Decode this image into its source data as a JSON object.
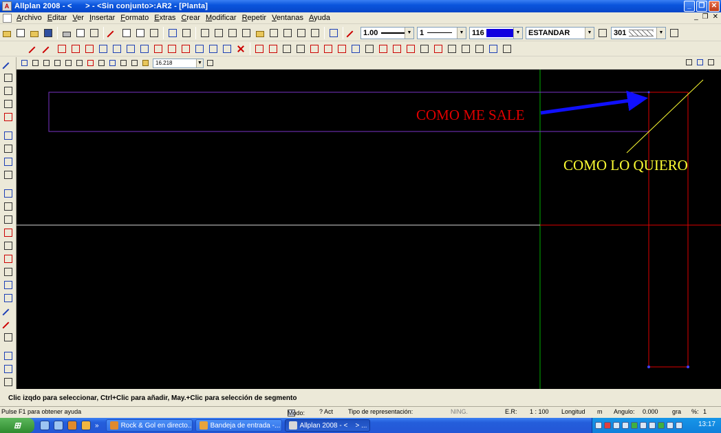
{
  "window": {
    "title": "Allplan 2008 - <      > - <Sin conjunto>:AR2 - [Planta]",
    "app_icon": "allplan-logo-icon",
    "controls": [
      "minimize-icon",
      "restore-icon",
      "close-icon"
    ]
  },
  "menu": {
    "items": [
      "Archivo",
      "Editar",
      "Ver",
      "Insertar",
      "Formato",
      "Extras",
      "Crear",
      "Modificar",
      "Repetir",
      "Ventanas",
      "Ayuda"
    ]
  },
  "toolbar": {
    "pen_thickness": "1.00",
    "line_type": "1",
    "color_number": "116",
    "color_hex": "#1000e0",
    "layer": "ESTANDAR",
    "hatch_number": "301",
    "zoom_value": "16.218"
  },
  "canvas": {
    "background": "#000000",
    "annotation_red": "COMO ME SALE",
    "annotation_yellow": "COMO LO QUIERO",
    "colors": {
      "purple_outline": "#7a35c8",
      "red_outline": "#e00000",
      "arrow_blue": "#1010ff",
      "green_axis": "#00b000",
      "white_axis": "#d8d8d8",
      "yellow_line": "#ffff33"
    }
  },
  "status": {
    "hint": "Clic izqdo para seleccionar, Ctrl+Clic para añadir, May.+Clic para selección de segmento",
    "help": "Pulse F1 para obtener ayuda",
    "mode_label": "Modo:",
    "mode_value": "? Act",
    "representation_label": "Tipo de representación:",
    "representation_value": "NING.",
    "scale_label": "E.R:",
    "scale_value": "1 : 100",
    "length_label": "Longitud",
    "length_unit": "m",
    "angle_label": "Angulo:",
    "angle_value": "0.000",
    "angle_unit": "gra",
    "percent_label": "%:",
    "percent_value": "1"
  },
  "taskbar": {
    "tasks": [
      {
        "label": "Rock & Gol en directo...",
        "icon": "firefox-icon"
      },
      {
        "label": "Bandeja de entrada -...",
        "icon": "mail-icon"
      },
      {
        "label": "Allplan 2008 - <    > ...",
        "icon": "allplan-icon"
      }
    ],
    "clock": "13:17"
  }
}
